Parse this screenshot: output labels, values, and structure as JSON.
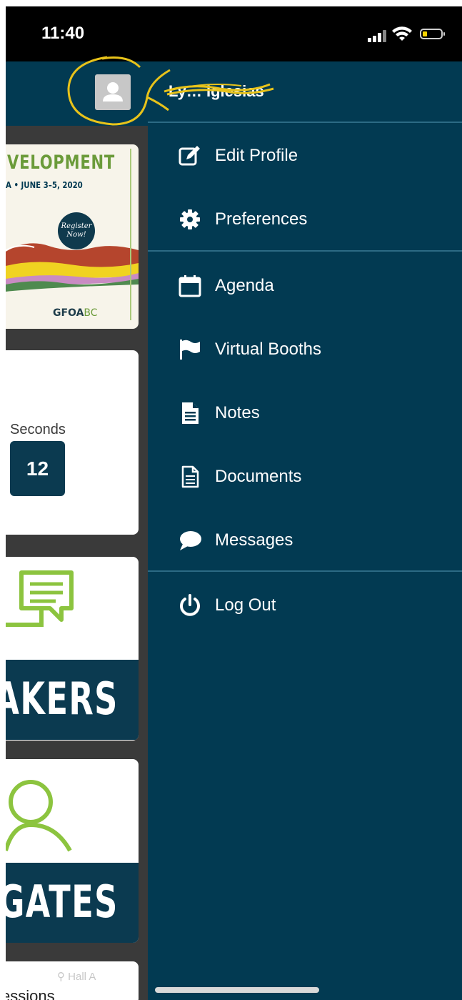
{
  "status_bar": {
    "time": "11:40",
    "icons": [
      "cellular-signal-icon",
      "wifi-icon",
      "battery-low-icon"
    ]
  },
  "background": {
    "poster": {
      "title": "VELOPMENT",
      "date": "A • JUNE 3–5, 2020",
      "badge": "Register Now!",
      "logo": "GFOA",
      "logo_suffix": "BC"
    },
    "countdown": {
      "label": "Seconds",
      "value": "12"
    },
    "tiles": [
      {
        "label": "AKERS",
        "icon": "speech-bubble-icon"
      },
      {
        "label": "EGATES",
        "icon": "person-outline-icon"
      }
    ],
    "sessions": {
      "location": "Hall A",
      "label": "essions"
    }
  },
  "drawer": {
    "user_name": "Ly… Iglesias",
    "menu_groups": [
      [
        {
          "label": "Edit Profile",
          "icon": "edit-icon"
        },
        {
          "label": "Preferences",
          "icon": "gear-icon"
        }
      ],
      [
        {
          "label": "Agenda",
          "icon": "calendar-icon"
        },
        {
          "label": "Virtual Booths",
          "icon": "flag-icon"
        },
        {
          "label": "Notes",
          "icon": "note-icon"
        },
        {
          "label": "Documents",
          "icon": "document-icon"
        },
        {
          "label": "Messages",
          "icon": "chat-bubble-icon"
        }
      ],
      [
        {
          "label": "Log Out",
          "icon": "power-icon"
        }
      ]
    ]
  },
  "colors": {
    "drawer_bg": "#023a52",
    "divider": "#2c6a84",
    "accent_green": "#6b9b3a",
    "highlight_annotation": "#e8c31a"
  }
}
